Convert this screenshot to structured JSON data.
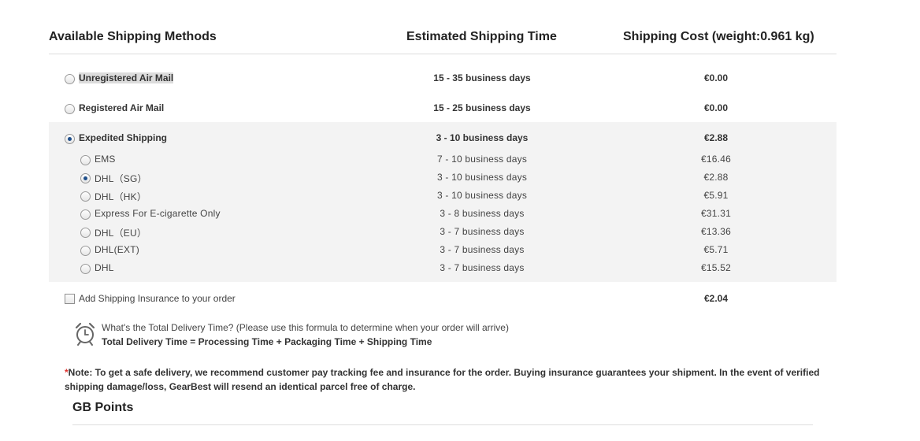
{
  "header": {
    "method": "Available Shipping Methods",
    "time": "Estimated Shipping Time",
    "cost": "Shipping Cost (weight:0.961 kg)"
  },
  "methods": [
    {
      "label": "Unregistered Air Mail",
      "time": "15 - 35 business days",
      "cost": "€0.00",
      "selected": false
    },
    {
      "label": "Registered Air Mail",
      "time": "15 - 25 business days",
      "cost": "€0.00",
      "selected": false
    },
    {
      "label": "Expedited Shipping",
      "time": "3 - 10 business days",
      "cost": "€2.88",
      "selected": true
    }
  ],
  "expedited_options": [
    {
      "label": "EMS",
      "time": "7 - 10 business days",
      "cost": "€16.46",
      "selected": false
    },
    {
      "label": "DHL（SG）",
      "time": "3 - 10 business days",
      "cost": "€2.88",
      "selected": true
    },
    {
      "label": "DHL（HK）",
      "time": "3 - 10 business days",
      "cost": "€5.91",
      "selected": false
    },
    {
      "label": "Express For E-cigarette Only",
      "time": "3 - 8 business days",
      "cost": "€31.31",
      "selected": false
    },
    {
      "label": "DHL（EU）",
      "time": "3 - 7 business days",
      "cost": "€13.36",
      "selected": false
    },
    {
      "label": "DHL(EXT)",
      "time": "3 - 7 business days",
      "cost": "€5.71",
      "selected": false
    },
    {
      "label": "DHL",
      "time": "3 - 7 business days",
      "cost": "€15.52",
      "selected": false
    }
  ],
  "insurance": {
    "label": "Add Shipping Insurance to your order",
    "cost": "€2.04",
    "checked": false
  },
  "delivery_tip": {
    "question": "What's the Total Delivery Time? (Please use this formula to determine when your order will arrive)",
    "formula": "Total Delivery Time = Processing Time + Packaging Time + Shipping Time",
    "icon": "alarm-clock-icon"
  },
  "note": {
    "star": "*",
    "text": "Note: To get a safe delivery, we recommend customer pay tracking fee and insurance for the order. Buying insurance guarantees your shipment. In the event of verified shipping damage/loss, GearBest will resend an identical parcel free of charge."
  },
  "gb_points": {
    "title": "GB Points"
  }
}
